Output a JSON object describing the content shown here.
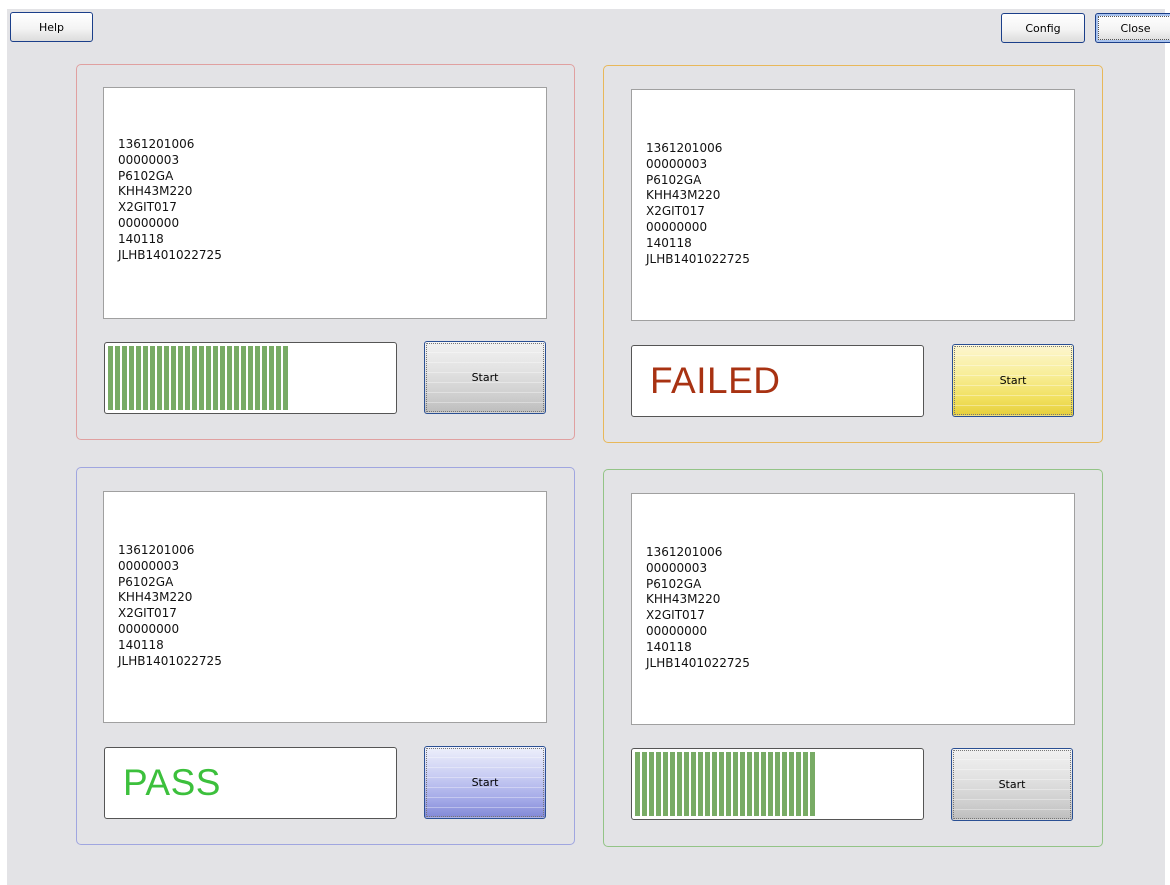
{
  "toolbar": {
    "help_label": "Help",
    "config_label": "Config",
    "close_label": "Close"
  },
  "stations": [
    {
      "border_color": "#e0a0a0",
      "lines": [
        "1361201006",
        "00000003",
        "P6102GA",
        "KHH43M220",
        "X2GIT017",
        "00000000",
        "140118",
        "JLHB1401022725"
      ],
      "status": "progress",
      "status_text": "",
      "progress_fraction": 0.62,
      "start_label": "Start",
      "start_style": "gray"
    },
    {
      "border_color": "#e8b85a",
      "lines": [
        "1361201006",
        "00000003",
        "P6102GA",
        "KHH43M220",
        "X2GIT017",
        "00000000",
        "140118",
        "JLHB1401022725"
      ],
      "status": "failed",
      "status_text": "FAILED",
      "status_color": "#a83212",
      "start_label": "Start",
      "start_style": "yellow"
    },
    {
      "border_color": "#a0a6e0",
      "lines": [
        "1361201006",
        "00000003",
        "P6102GA",
        "KHH43M220",
        "X2GIT017",
        "00000000",
        "140118",
        "JLHB1401022725"
      ],
      "status": "pass",
      "status_text": "PASS",
      "status_color": "#3cc03c",
      "start_label": "Start",
      "start_style": "blue"
    },
    {
      "border_color": "#93c487",
      "lines": [
        "1361201006",
        "00000003",
        "P6102GA",
        "KHH43M220",
        "X2GIT017",
        "00000000",
        "140118",
        "JLHB1401022725"
      ],
      "status": "progress",
      "status_text": "",
      "progress_fraction": 0.62,
      "start_label": "Start",
      "start_style": "gray"
    }
  ]
}
